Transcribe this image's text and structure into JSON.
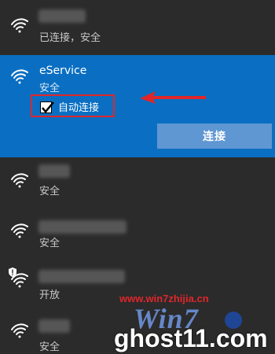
{
  "networks": [
    {
      "id": "net-1",
      "ssid": "",
      "status": "已连接，安全"
    },
    {
      "id": "net-2",
      "ssid": "eService",
      "status": "安全",
      "auto_connect_label": "自动连接",
      "auto_connect_checked": true,
      "connect_label": "连接"
    },
    {
      "id": "net-3",
      "ssid": "",
      "status": "安全"
    },
    {
      "id": "net-4",
      "ssid": "",
      "status": "安全"
    },
    {
      "id": "net-5",
      "ssid": "",
      "status": "开放"
    },
    {
      "id": "net-6",
      "ssid": "",
      "status": "安全"
    }
  ],
  "watermark": {
    "url": "www.win7zhijia.cn",
    "logo": "Win7",
    "site": "ghost11.com"
  },
  "colors": {
    "panel_bg": "#2b2b2b",
    "selected_bg": "#0a6fc2",
    "button_bg": "#5f97d2",
    "highlight_red": "#e0262a"
  },
  "icons": {
    "wifi": "wifi-signal-icon",
    "shield": "shield-warning-icon",
    "check": "checkmark-icon",
    "arrow": "annotation-arrow-icon"
  }
}
